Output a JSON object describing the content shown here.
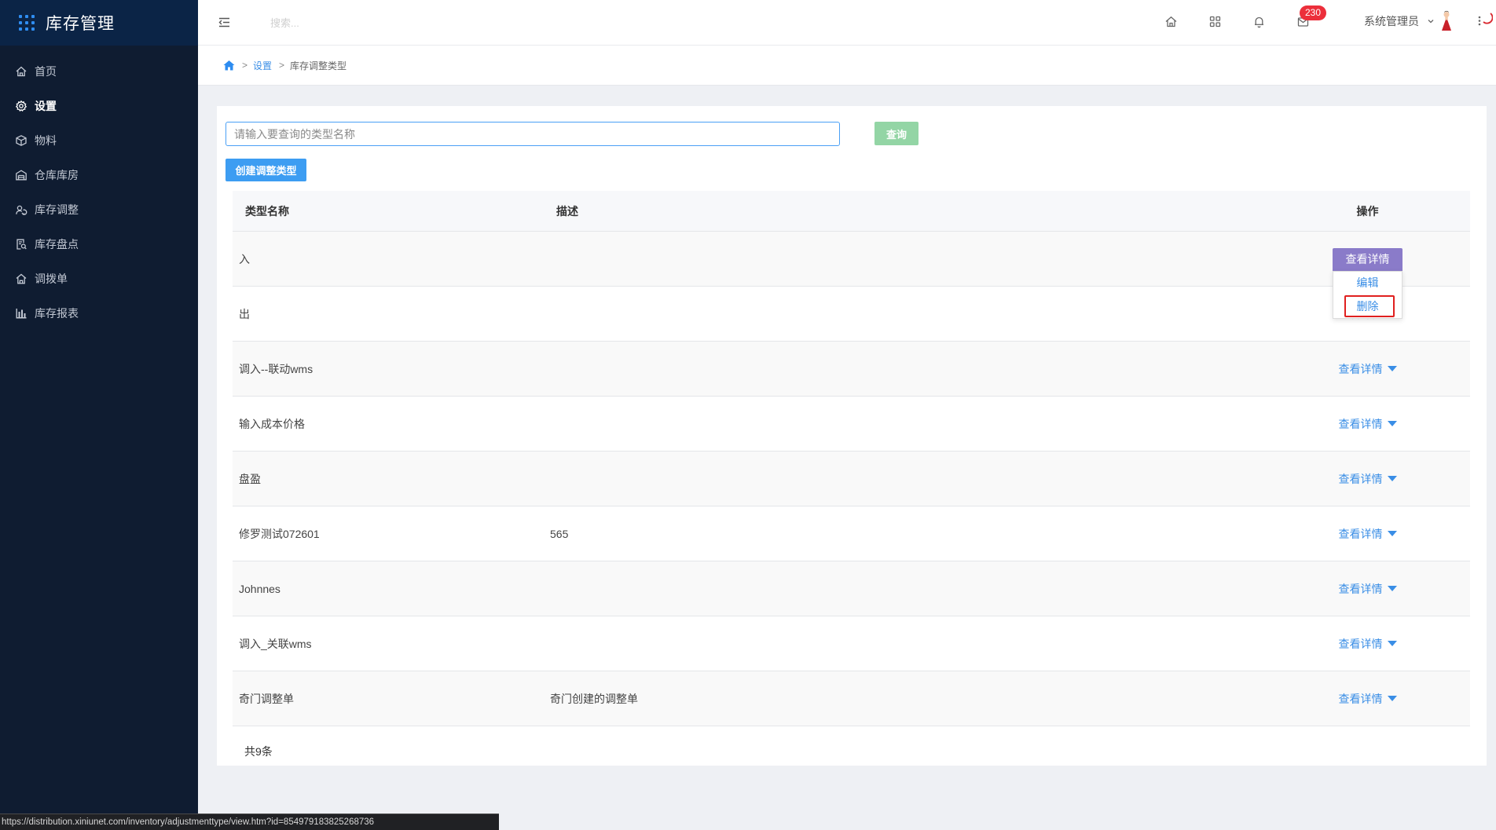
{
  "app": {
    "title": "库存管理"
  },
  "colors": {
    "sidebar_bg": "#0f1c31",
    "logo_bg": "#0b2446",
    "accent": "#3d9df2",
    "link": "#3a8ee6",
    "query_button": "#93d5a5",
    "dropdown_active": "#8a7bc9",
    "badge": "#ec2f3b",
    "highlight_box": "#e0201f"
  },
  "sidebar": {
    "items": [
      {
        "label": "首页",
        "icon": "home-icon"
      },
      {
        "label": "设置",
        "icon": "gear-icon",
        "active": true
      },
      {
        "label": "物料",
        "icon": "cube-icon"
      },
      {
        "label": "仓库库房",
        "icon": "warehouse-icon"
      },
      {
        "label": "库存调整",
        "icon": "adjust-icon"
      },
      {
        "label": "库存盘点",
        "icon": "clipboard-search-icon"
      },
      {
        "label": "调拨单",
        "icon": "transfer-icon"
      },
      {
        "label": "库存报表",
        "icon": "bar-chart-icon"
      }
    ]
  },
  "header": {
    "search_placeholder": "搜索...",
    "notification_count": "230",
    "user_name": "系统管理员",
    "icons": [
      "menu-fold-icon",
      "home-icon",
      "apps-grid-icon",
      "bell-icon",
      "message-icon",
      "chevron-down-icon",
      "avatar",
      "more-icon"
    ]
  },
  "breadcrumb": {
    "items": [
      "设置",
      "库存调整类型"
    ]
  },
  "search": {
    "placeholder": "请输入要查询的类型名称",
    "value": "",
    "button_label": "查询"
  },
  "toolbar": {
    "create_label": "创建调整类型"
  },
  "table": {
    "columns": [
      "类型名称",
      "描述",
      "操作"
    ],
    "rows": [
      {
        "name": "入",
        "description": "",
        "action": "查看详情",
        "menu_open": true
      },
      {
        "name": "出",
        "description": "",
        "action": "查看详情"
      },
      {
        "name": "调入--联动wms",
        "description": "",
        "action": "查看详情"
      },
      {
        "name": "输入成本价格",
        "description": "",
        "action": "查看详情"
      },
      {
        "name": "盘盈",
        "description": "",
        "action": "查看详情"
      },
      {
        "name": "修罗测试072601",
        "description": "565",
        "action": "查看详情"
      },
      {
        "name": "Johnnes",
        "description": "",
        "action": "查看详情"
      },
      {
        "name": "调入_关联wms",
        "description": "",
        "action": "查看详情"
      },
      {
        "name": "奇门调整单",
        "description": "奇门创建的调整单",
        "action": "查看详情"
      }
    ]
  },
  "action_menu": {
    "items": [
      {
        "label": "编辑"
      },
      {
        "label": "删除",
        "highlighted": true
      }
    ]
  },
  "pagination": {
    "total_text": "共9条"
  },
  "status_bar": {
    "url": "https://distribution.xiniunet.com/inventory/adjustmenttype/view.htm?id=854979183825268736"
  }
}
